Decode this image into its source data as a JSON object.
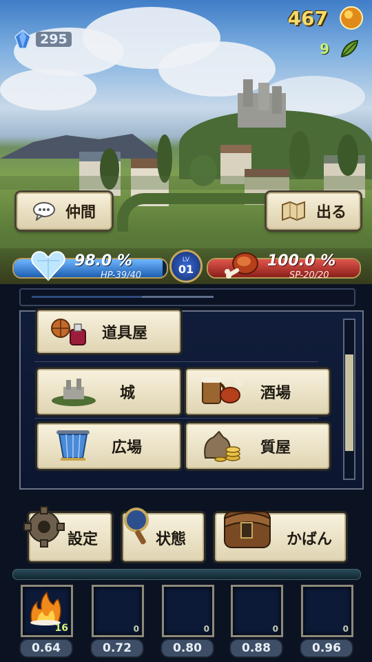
{
  "header": {
    "crystals": "295",
    "gold": "467",
    "leaves": "9"
  },
  "top_buttons": {
    "party_label": "仲間",
    "exit_label": "出る"
  },
  "stats": {
    "hp_percent": "98.0 %",
    "hp_detail": "HP-39/40",
    "hp_fill": 0.975,
    "level_prefix": "LV",
    "level": "01",
    "sp_percent": "100.0 %",
    "sp_detail": "SP-20/20",
    "sp_fill": 1.0
  },
  "locations": [
    {
      "label": "道具屋",
      "icon": "item-shop-icon"
    },
    {
      "label": "城",
      "icon": "castle-icon"
    },
    {
      "label": "酒場",
      "icon": "tavern-icon"
    },
    {
      "label": "広場",
      "icon": "plaza-icon"
    },
    {
      "label": "質屋",
      "icon": "pawnshop-icon"
    }
  ],
  "bottom_buttons": {
    "settings_label": "設定",
    "status_label": "状態",
    "bag_label": "かばん"
  },
  "slots": [
    {
      "count": "16",
      "speed": "0.64",
      "item": "fire-icon"
    },
    {
      "count": "0",
      "speed": "0.72"
    },
    {
      "count": "0",
      "speed": "0.80"
    },
    {
      "count": "0",
      "speed": "0.88"
    },
    {
      "count": "0",
      "speed": "0.96"
    }
  ],
  "colors": {
    "hp_bar": "#2f7fd6",
    "sp_bar": "#c0332c",
    "gold_text": "#f3dc6a"
  }
}
